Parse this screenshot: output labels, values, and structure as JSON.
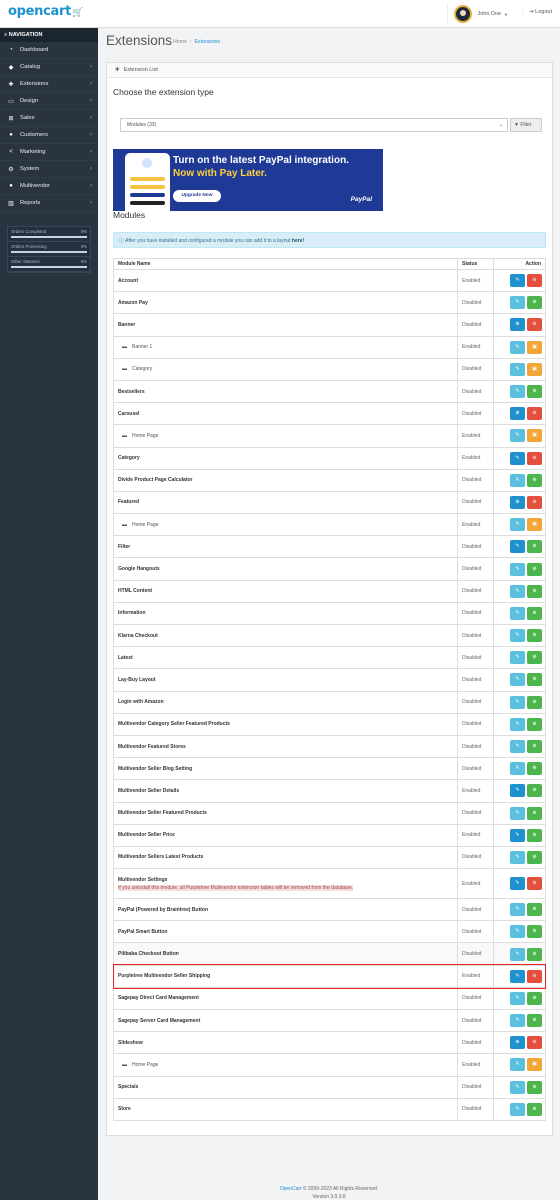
{
  "header": {
    "logo": "opencart",
    "user_name": "John Doe",
    "logout_label": "Logout",
    "colors": {
      "brand": "#1e91cf"
    }
  },
  "sidebar": {
    "heading": "NAVIGATION",
    "items": [
      {
        "label": "Dashboard",
        "icon": "dashboard-icon",
        "arrow": false
      },
      {
        "label": "Catalog",
        "icon": "tag-icon",
        "arrow": true
      },
      {
        "label": "Extensions",
        "icon": "puzzle-icon",
        "arrow": true
      },
      {
        "label": "Design",
        "icon": "monitor-icon",
        "arrow": true
      },
      {
        "label": "Sales",
        "icon": "cart-icon",
        "arrow": true
      },
      {
        "label": "Customers",
        "icon": "user-icon",
        "arrow": true
      },
      {
        "label": "Marketing",
        "icon": "share-icon",
        "arrow": true
      },
      {
        "label": "System",
        "icon": "gear-icon",
        "arrow": true
      },
      {
        "label": "Multivendor",
        "icon": "user-icon",
        "arrow": true
      },
      {
        "label": "Reports",
        "icon": "bar-chart-icon",
        "arrow": true
      }
    ],
    "stats": [
      {
        "label": "Orders Completed",
        "value": "0%",
        "progress": 0
      },
      {
        "label": "Orders Processing",
        "value": "0%",
        "progress": 0
      },
      {
        "label": "Other Statuses",
        "value": "0%",
        "progress": 0
      }
    ]
  },
  "page": {
    "title": "Extensions",
    "breadcrumb": [
      "Home",
      "Extensions"
    ]
  },
  "panel": {
    "heading": "Extension List",
    "choose_title": "Choose the extension type",
    "select_value": "Modules (33)",
    "filter_label": "Filter",
    "paypal": {
      "line1": "Turn on the latest PayPal integration.",
      "line2": "Now with Pay Later.",
      "button": "Upgrade Now",
      "logo": "PayPal"
    },
    "modules_title": "Modules",
    "alert_text": "After you have installed and configured a module you can add it to a layout",
    "alert_link": "here!",
    "columns": {
      "name": "Module Name",
      "status": "Status",
      "action": "Action"
    }
  },
  "modules": [
    {
      "name": "Account",
      "status": "Enabled",
      "sub": false,
      "btn": "edit",
      "edit_color": "blue",
      "second": "uninstall"
    },
    {
      "name": "Amazon Pay",
      "status": "Disabled",
      "sub": false,
      "btn": "edit",
      "edit_color": "lblue",
      "second": "install"
    },
    {
      "name": "Banner",
      "status": "Disabled",
      "sub": false,
      "btn": "add",
      "edit_color": "blue",
      "second": "uninstall"
    },
    {
      "name": "Banner 1",
      "status": "Enabled",
      "sub": true,
      "btn": "edit",
      "edit_color": "lblue",
      "second": "delete"
    },
    {
      "name": "Category",
      "status": "Disabled",
      "sub": true,
      "btn": "edit",
      "edit_color": "lblue",
      "second": "delete"
    },
    {
      "name": "Bestsellers",
      "status": "Disabled",
      "sub": false,
      "btn": "edit",
      "edit_color": "lblue",
      "second": "install"
    },
    {
      "name": "Carousel",
      "status": "Disabled",
      "sub": false,
      "btn": "add",
      "edit_color": "blue",
      "second": "uninstall"
    },
    {
      "name": "Home Page",
      "status": "Enabled",
      "sub": true,
      "btn": "edit",
      "edit_color": "lblue",
      "second": "delete"
    },
    {
      "name": "Category",
      "status": "Enabled",
      "sub": false,
      "btn": "edit",
      "edit_color": "blue",
      "second": "uninstall"
    },
    {
      "name": "Divide Product Page Calculator",
      "status": "Disabled",
      "sub": false,
      "btn": "edit",
      "edit_color": "lblue",
      "second": "install"
    },
    {
      "name": "Featured",
      "status": "Disabled",
      "sub": false,
      "btn": "add",
      "edit_color": "blue",
      "second": "uninstall"
    },
    {
      "name": "Home Page",
      "status": "Enabled",
      "sub": true,
      "btn": "edit",
      "edit_color": "lblue",
      "second": "delete"
    },
    {
      "name": "Filter",
      "status": "Disabled",
      "sub": false,
      "btn": "edit",
      "edit_color": "blue",
      "second": "install"
    },
    {
      "name": "Google Hangouts",
      "status": "Disabled",
      "sub": false,
      "btn": "edit",
      "edit_color": "lblue",
      "second": "install"
    },
    {
      "name": "HTML Content",
      "status": "Disabled",
      "sub": false,
      "btn": "edit",
      "edit_color": "lblue",
      "second": "install"
    },
    {
      "name": "Information",
      "status": "Disabled",
      "sub": false,
      "btn": "edit",
      "edit_color": "lblue",
      "second": "install"
    },
    {
      "name": "Klarna Checkout",
      "status": "Disabled",
      "sub": false,
      "btn": "edit",
      "edit_color": "lblue",
      "second": "install"
    },
    {
      "name": "Latest",
      "status": "Disabled",
      "sub": false,
      "btn": "edit",
      "edit_color": "lblue",
      "second": "install"
    },
    {
      "name": "Lay-Buy Layout",
      "status": "Disabled",
      "sub": false,
      "btn": "edit",
      "edit_color": "lblue",
      "second": "install"
    },
    {
      "name": "Login with Amazon",
      "status": "Disabled",
      "sub": false,
      "btn": "edit",
      "edit_color": "lblue",
      "second": "install"
    },
    {
      "name": "Multivendor Category Seller Featured Products",
      "status": "Disabled",
      "sub": false,
      "btn": "edit",
      "edit_color": "lblue",
      "second": "install"
    },
    {
      "name": "Multivendor Featured Stores",
      "status": "Disabled",
      "sub": false,
      "btn": "edit",
      "edit_color": "lblue",
      "second": "install"
    },
    {
      "name": "Multivendor Seller Blog Setting",
      "status": "Disabled",
      "sub": false,
      "btn": "edit",
      "edit_color": "lblue",
      "second": "install"
    },
    {
      "name": "Multivendor Seller Details",
      "status": "Enabled",
      "sub": false,
      "btn": "edit",
      "edit_color": "blue",
      "second": "install"
    },
    {
      "name": "Multivendor Seller Featured Products",
      "status": "Disabled",
      "sub": false,
      "btn": "edit",
      "edit_color": "lblue",
      "second": "install"
    },
    {
      "name": "Multivendor Seller Price",
      "status": "Enabled",
      "sub": false,
      "btn": "edit",
      "edit_color": "blue",
      "second": "install"
    },
    {
      "name": "Multivendor Sellers Latest Products",
      "status": "Disabled",
      "sub": false,
      "btn": "edit",
      "edit_color": "lblue",
      "second": "install"
    },
    {
      "name": "Multivendor Settings",
      "status": "Enabled",
      "sub": false,
      "btn": "edit",
      "edit_color": "blue",
      "second": "uninstall",
      "warning": "If you uninstall this module, all Purpletree Multivendor extension tables will be removed from the database."
    },
    {
      "name": "PayPal (Powered by Braintree) Button",
      "status": "Disabled",
      "sub": false,
      "btn": "edit",
      "edit_color": "lblue",
      "second": "install"
    },
    {
      "name": "PayPal Smart Button",
      "status": "Disabled",
      "sub": false,
      "btn": "edit",
      "edit_color": "lblue",
      "second": "install"
    },
    {
      "name": "Pilibaba Checkout Button",
      "status": "Disabled",
      "sub": false,
      "btn": "edit",
      "edit_color": "lblue",
      "second": "install"
    },
    {
      "name": "Purpletree Multivendor Seller Shipping",
      "status": "Enabled",
      "sub": false,
      "btn": "edit",
      "edit_color": "blue",
      "second": "uninstall"
    },
    {
      "name": "Sagepay Direct Card Management",
      "status": "Disabled",
      "sub": false,
      "btn": "edit",
      "edit_color": "lblue",
      "second": "install"
    },
    {
      "name": "Sagepay Server Card Management",
      "status": "Disabled",
      "sub": false,
      "btn": "edit",
      "edit_color": "lblue",
      "second": "install"
    },
    {
      "name": "Slideshow",
      "status": "Disabled",
      "sub": false,
      "btn": "add",
      "edit_color": "blue",
      "second": "uninstall"
    },
    {
      "name": "Home Page",
      "status": "Enabled",
      "sub": true,
      "btn": "edit",
      "edit_color": "lblue",
      "second": "delete"
    },
    {
      "name": "Specials",
      "status": "Disabled",
      "sub": false,
      "btn": "edit",
      "edit_color": "lblue",
      "second": "install"
    },
    {
      "name": "Store",
      "status": "Disabled",
      "sub": false,
      "btn": "edit",
      "edit_color": "lblue",
      "second": "install"
    }
  ],
  "footer": {
    "link": "OpenCart",
    "copyright": "© 2009-2023 All Rights Reserved.",
    "version": "Version 3.0.3.8"
  }
}
